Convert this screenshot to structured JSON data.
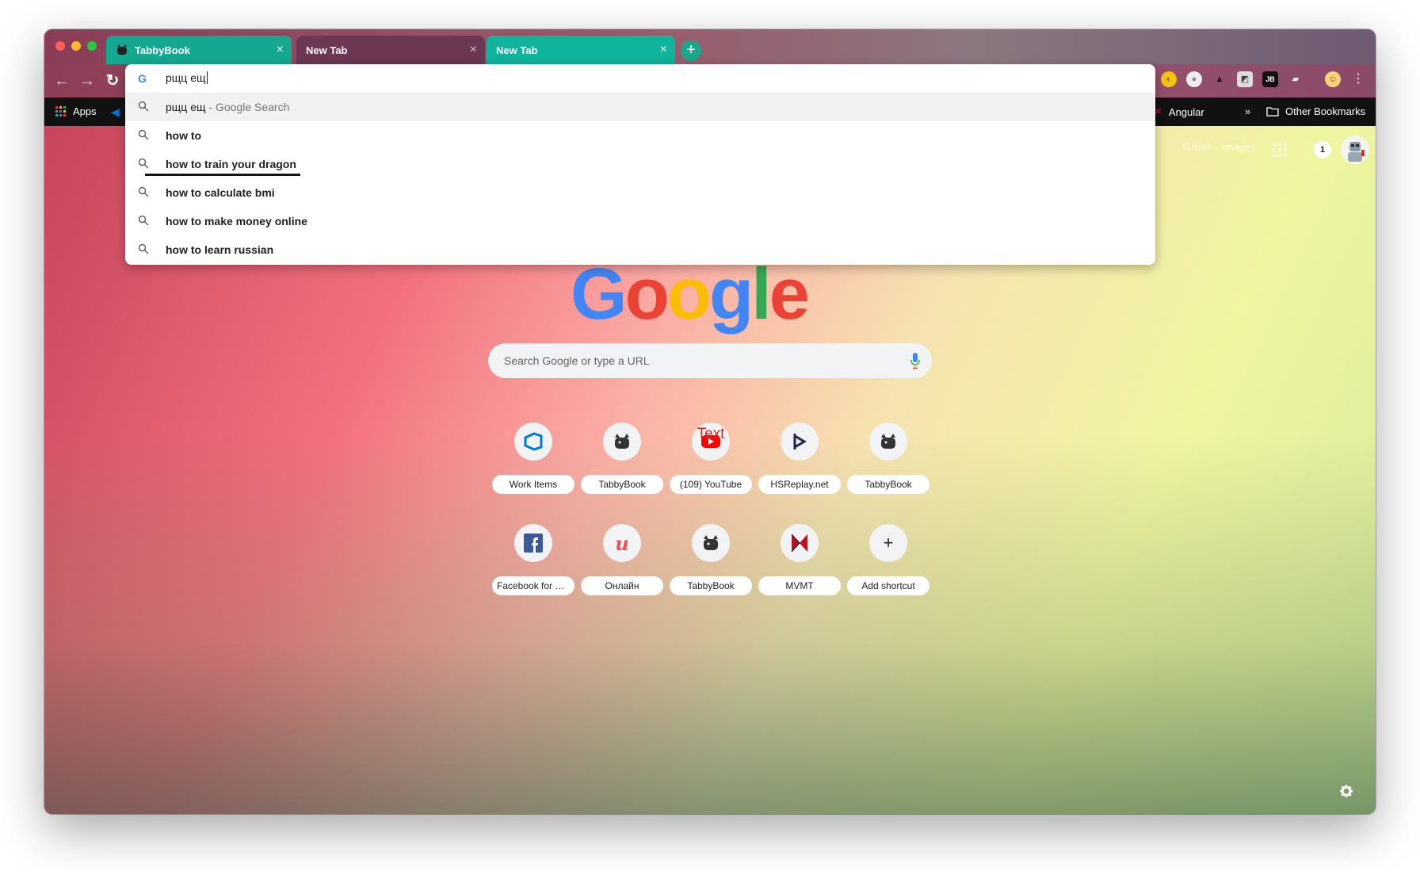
{
  "tabs": [
    {
      "title": "TabbyBook",
      "favicon": "cat-icon",
      "active": true
    },
    {
      "title": "New Tab",
      "favicon": "",
      "active": false
    },
    {
      "title": "New Tab",
      "favicon": "",
      "active": false
    }
  ],
  "new_tab_label": "+",
  "omnibox": {
    "query": "рщц ещ",
    "suggestions": [
      {
        "text": "рщц ещ",
        "suffix": " - Google Search",
        "type": "search",
        "selected": true
      },
      {
        "text": "how to",
        "type": "search"
      },
      {
        "text": "how to train your dragon",
        "type": "search"
      },
      {
        "text": "how to calculate bmi",
        "type": "search"
      },
      {
        "text": "how to make money online",
        "type": "search"
      },
      {
        "text": "how to learn russian",
        "type": "search"
      }
    ]
  },
  "bookmarks": {
    "apps_label": "Apps",
    "angular_label": "Angular",
    "overflow_label": "»",
    "other_label": "Other Bookmarks"
  },
  "header": {
    "gmail": "Gmail",
    "images": "Images",
    "notifications": "1"
  },
  "logo_letters": [
    {
      "ch": "G",
      "color": "#4285f4"
    },
    {
      "ch": "o",
      "color": "#ea4335"
    },
    {
      "ch": "o",
      "color": "#fbbc05"
    },
    {
      "ch": "g",
      "color": "#4285f4"
    },
    {
      "ch": "l",
      "color": "#34a853"
    },
    {
      "ch": "e",
      "color": "#ea4335"
    }
  ],
  "search": {
    "placeholder": "Search Google or type a URL"
  },
  "shortcuts": [
    {
      "title": "Work Items",
      "icon": "azure-devops-icon"
    },
    {
      "title": "TabbyBook",
      "icon": "cat-icon"
    },
    {
      "title": "(109) YouTube",
      "icon": "youtube-icon",
      "overlay_text": "Text"
    },
    {
      "title": "HSReplay.net",
      "icon": "hsreplay-icon"
    },
    {
      "title": "TabbyBook",
      "icon": "cat-icon"
    },
    {
      "title": "Facebook for D...",
      "icon": "facebook-icon"
    },
    {
      "title": "Онлайн",
      "icon": "udemy-icon"
    },
    {
      "title": "TabbyBook",
      "icon": "cat-icon"
    },
    {
      "title": "MVMT",
      "icon": "mvmt-icon"
    },
    {
      "title": "Add shortcut",
      "icon": "plus-icon",
      "glyph": "+"
    }
  ],
  "colors": {
    "active_tab": "#14a890",
    "inactive_tab": "#6b3752",
    "google_blue": "#4285f4"
  }
}
